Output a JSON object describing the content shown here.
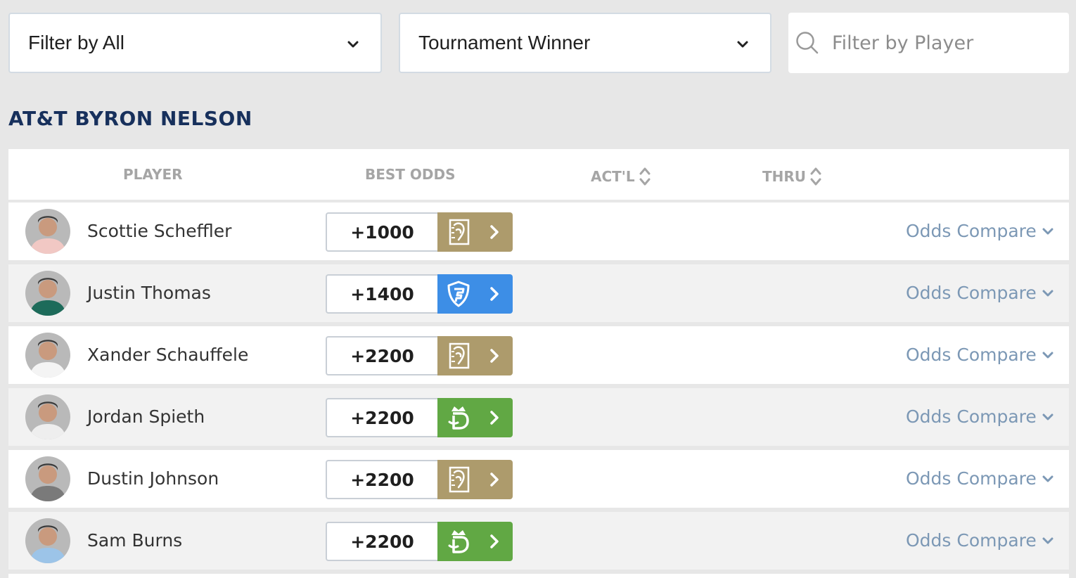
{
  "filters": {
    "filter_all": "Filter by All",
    "market": "Tournament Winner",
    "player_search_placeholder": "Filter by Player"
  },
  "event": {
    "title": "AT&T BYRON NELSON"
  },
  "columns": {
    "player": "PLAYER",
    "best_odds": "BEST ODDS",
    "actl": "ACT'L",
    "thru": "THRU"
  },
  "compare_label": "Odds Compare",
  "book_colors": {
    "betmgm": "#ad9b6c",
    "fanduel": "#3d8ee6",
    "draftkings": "#61a844"
  },
  "players": [
    {
      "name": "Scottie Scheffler",
      "odds": "+1000",
      "book": "betmgm",
      "book_icon": "betmgm-lion-icon",
      "shirt": "#f1c8c4"
    },
    {
      "name": "Justin Thomas",
      "odds": "+1400",
      "book": "fanduel",
      "book_icon": "fanduel-shield-icon",
      "shirt": "#1d6b5a"
    },
    {
      "name": "Xander Schauffele",
      "odds": "+2200",
      "book": "betmgm",
      "book_icon": "betmgm-lion-icon",
      "shirt": "#f4f4f4"
    },
    {
      "name": "Jordan Spieth",
      "odds": "+2200",
      "book": "draftkings",
      "book_icon": "draftkings-crown-icon",
      "shirt": "#eeeeee"
    },
    {
      "name": "Dustin Johnson",
      "odds": "+2200",
      "book": "betmgm",
      "book_icon": "betmgm-lion-icon",
      "shirt": "#7a7a7a"
    },
    {
      "name": "Sam Burns",
      "odds": "+2200",
      "book": "draftkings",
      "book_icon": "draftkings-crown-icon",
      "shirt": "#9cc4e8"
    }
  ]
}
